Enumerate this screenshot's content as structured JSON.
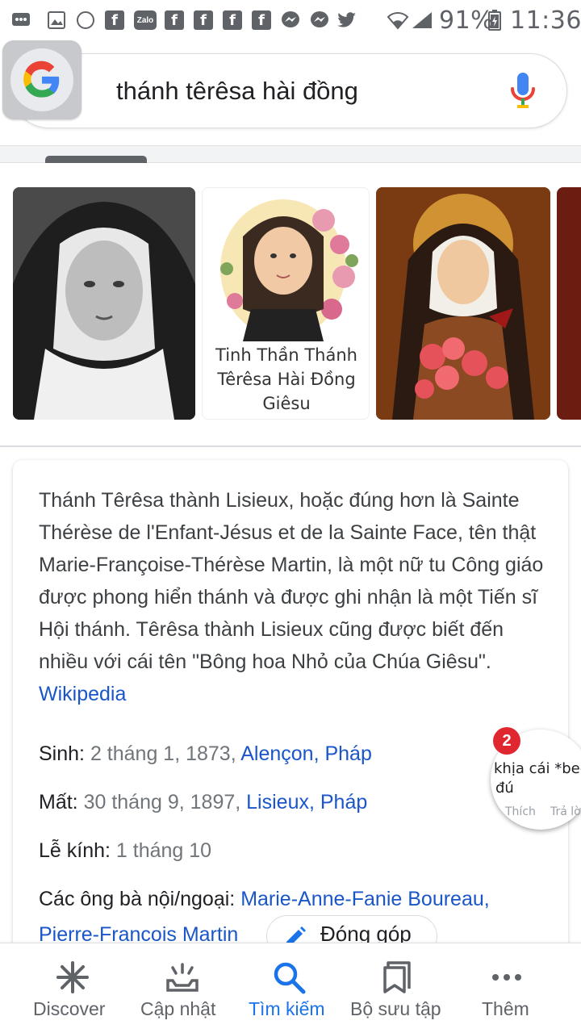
{
  "status_bar": {
    "battery": "91%",
    "time": "11:36",
    "fb_glyph": "f",
    "zalo_glyph": "Zalo"
  },
  "search": {
    "query": "thánh têrêsa hài đồng",
    "logo_icon": "google-g-icon",
    "mic_icon": "microphone-icon"
  },
  "images": {
    "items": [
      {
        "alt": "black-and-white portrait"
      },
      {
        "caption": "Tinh Thần Thánh Têrêsa Hài Đồng Giêsu"
      },
      {
        "alt": "painted portrait with roses"
      },
      {
        "alt": "partial image"
      }
    ]
  },
  "knowledge": {
    "description": "Thánh Têrêsa thành Lisieux, hoặc đúng hơn là Sainte Thérèse de l'Enfant-Jésus et de la Sainte Face, tên thật Marie-Françoise-Thérèse Martin, là một nữ tu Công giáo được phong hiển thánh và được ghi nhận là một Tiến sĩ Hội thánh. Têrêsa thành Lisieux cũng được biết đến nhiều với cái tên \"Bông hoa Nhỏ của Chúa Giêsu\".",
    "source": "Wikipedia",
    "facts": {
      "birth": {
        "label": "Sinh:",
        "value": "2 tháng 1, 1873,",
        "link": "Alençon, Pháp"
      },
      "death": {
        "label": "Mất:",
        "value": "30 tháng 9, 1897,",
        "link": "Lisieux, Pháp"
      },
      "feast": {
        "label": "Lễ kính:",
        "value": "1 tháng 10"
      },
      "grandparents": {
        "label": "Các ông bà nội/ngoại:",
        "link1": "Marie-Anne-Fanie Boureau,",
        "link2": "Pierre-Francois Martin"
      }
    },
    "contribute_label": "Đóng góp"
  },
  "chat_head": {
    "badge": "2",
    "line1": "khịa cái *beep",
    "line2": "đú",
    "like": "Thích",
    "reply": "Trả lời"
  },
  "bottom_nav": {
    "items": [
      {
        "label": "Discover",
        "icon": "asterisk-icon"
      },
      {
        "label": "Cập nhật",
        "icon": "updates-icon"
      },
      {
        "label": "Tìm kiếm",
        "icon": "search-icon",
        "active": true
      },
      {
        "label": "Bộ sưu tập",
        "icon": "collections-icon"
      },
      {
        "label": "Thêm",
        "icon": "more-icon"
      }
    ]
  },
  "colors": {
    "accent": "#1a73e8",
    "link": "#1a56c8",
    "badge": "#e0262f"
  }
}
